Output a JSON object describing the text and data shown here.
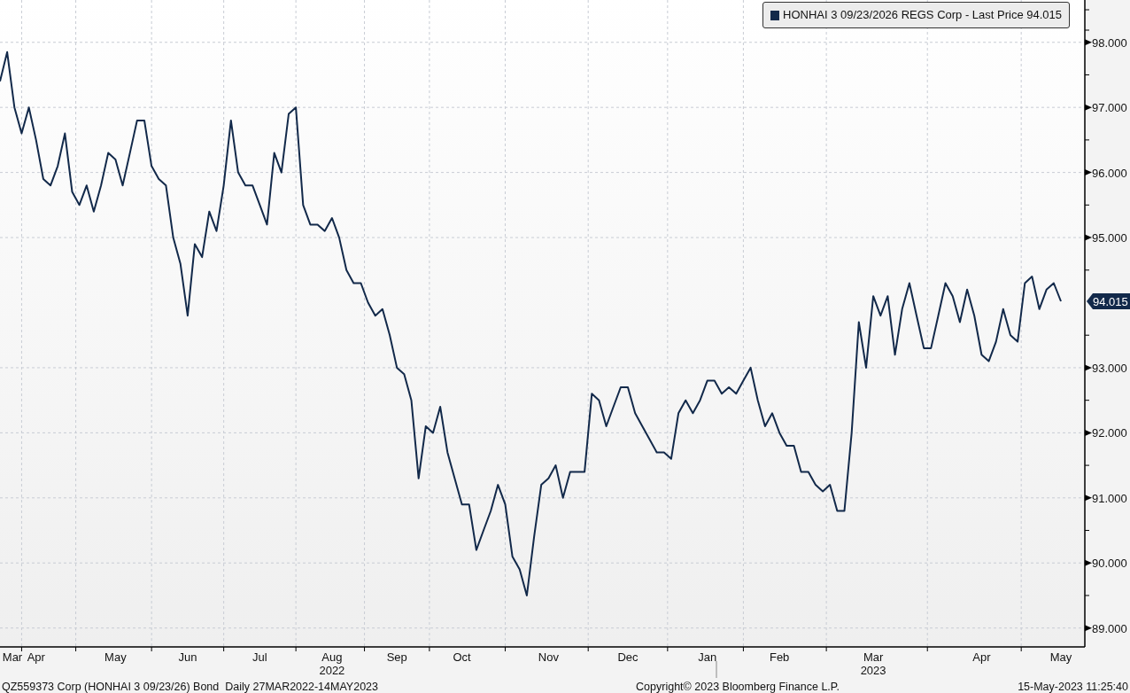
{
  "legend": {
    "label_suffix": "- Last Price 94.015"
  },
  "chart": {
    "chart_data": {
      "type": "line",
      "grid": true,
      "ylim": [
        88.71,
        98.65
      ],
      "yticks": [
        {
          "value": 89,
          "label": "89.000"
        },
        {
          "value": 90,
          "label": "90.000"
        },
        {
          "value": 91,
          "label": "91.000"
        },
        {
          "value": 92,
          "label": "92.000"
        },
        {
          "value": 93,
          "label": "93.000"
        },
        {
          "value": 95,
          "label": "95.000"
        },
        {
          "value": 96,
          "label": "96.000"
        },
        {
          "value": 97,
          "label": "97.000"
        },
        {
          "value": 98,
          "label": "98.000"
        }
      ],
      "categories": [
        null,
        "Mar",
        null,
        null,
        null,
        "Apr",
        null,
        null,
        null,
        null,
        null,
        null,
        null,
        null,
        null,
        null,
        "May",
        null,
        null,
        null,
        null,
        null,
        null,
        null,
        null,
        null,
        "Jun",
        null,
        null,
        null,
        null,
        null,
        null,
        null,
        null,
        null,
        "Jul",
        null,
        null,
        null,
        null,
        null,
        null,
        null,
        null,
        null,
        "Aug",
        null,
        null,
        null,
        null,
        null,
        null,
        null,
        null,
        "Sep",
        null,
        null,
        null,
        null,
        null,
        null,
        null,
        null,
        "Oct",
        null,
        null,
        null,
        null,
        null,
        null,
        null,
        null,
        null,
        null,
        null,
        "Nov",
        null,
        null,
        null,
        null,
        null,
        null,
        null,
        null,
        null,
        null,
        "Dec",
        null,
        null,
        null,
        null,
        null,
        null,
        null,
        null,
        null,
        null,
        "Jan",
        null,
        null,
        null,
        null,
        null,
        null,
        null,
        null,
        null,
        "Feb",
        null,
        null,
        null,
        null,
        null,
        null,
        null,
        null,
        null,
        null,
        null,
        null,
        "Mar",
        null,
        null,
        null,
        null,
        null,
        null,
        null,
        null,
        null,
        null,
        null,
        null,
        null,
        null,
        "Apr",
        null,
        null,
        null,
        null,
        null,
        null,
        null,
        null,
        null,
        null,
        "May"
      ],
      "annotations": [
        "2022",
        "2023",
        "94.015"
      ],
      "series": [
        {
          "name": "HONHAI 3 09/23/2026 REGS Corp",
          "color": "#12294a",
          "values": [
            97.4,
            97.85,
            97.0,
            96.6,
            97.0,
            96.5,
            95.9,
            95.8,
            96.1,
            96.6,
            95.7,
            95.5,
            95.8,
            95.4,
            95.8,
            96.3,
            96.2,
            95.8,
            96.3,
            96.8,
            96.8,
            96.1,
            95.9,
            95.8,
            95.0,
            94.6,
            93.8,
            94.9,
            94.7,
            95.4,
            95.1,
            95.8,
            96.8,
            96.0,
            95.8,
            95.8,
            95.5,
            95.2,
            96.3,
            96.0,
            96.9,
            97.0,
            95.5,
            95.2,
            95.2,
            95.1,
            95.3,
            95.0,
            94.5,
            94.3,
            94.3,
            94.0,
            93.8,
            93.9,
            93.5,
            93.0,
            92.9,
            92.5,
            91.3,
            92.1,
            92.0,
            92.4,
            91.7,
            91.3,
            90.9,
            90.9,
            90.2,
            90.5,
            90.8,
            91.2,
            90.9,
            90.1,
            89.9,
            89.5,
            90.4,
            91.2,
            91.3,
            91.5,
            91.0,
            91.4,
            91.4,
            91.4,
            92.6,
            92.5,
            92.1,
            92.4,
            92.7,
            92.7,
            92.3,
            92.1,
            91.9,
            91.7,
            91.7,
            91.6,
            92.3,
            92.5,
            92.3,
            92.5,
            92.8,
            92.8,
            92.6,
            92.7,
            92.6,
            92.8,
            93.0,
            92.5,
            92.1,
            92.3,
            92.0,
            91.8,
            91.8,
            91.4,
            91.4,
            91.2,
            91.1,
            91.2,
            90.8,
            90.8,
            92.0,
            93.7,
            93.0,
            94.1,
            93.8,
            94.1,
            93.2,
            93.9,
            94.3,
            93.8,
            93.3,
            93.3,
            93.8,
            94.3,
            94.1,
            93.7,
            94.2,
            93.8,
            93.2,
            93.1,
            93.4,
            93.9,
            93.5,
            93.4,
            94.3,
            94.4,
            93.9,
            94.2,
            94.3,
            94.02
          ]
        }
      ]
    }
  },
  "footer": {
    "left": "QZ559373 Corp (HONHAI 3 09/23/26) Bond  Daily 27MAR2022-14MAY2023",
    "center": "Copyright© 2023 Bloomberg Finance L.P.",
    "right": "15-May-2023 11:25:40"
  }
}
